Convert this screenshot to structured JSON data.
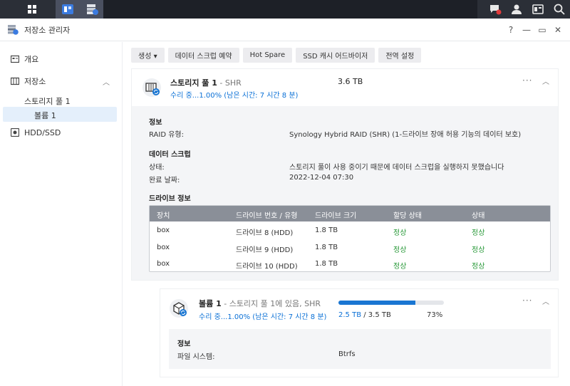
{
  "window": {
    "title": "저장소 관리자",
    "help": "?",
    "minimize": "—",
    "restore": "▭",
    "close": "✕"
  },
  "sidebar": {
    "overview": "개요",
    "storage": "저장소",
    "pool": "스토리지 풀 1",
    "volume": "볼륨 1",
    "hdd": "HDD/SSD"
  },
  "toolbar": {
    "create": "생성 ▾",
    "scrub": "데이터 스크럽 예약",
    "hotspare": "Hot Spare",
    "ssd": "SSD 캐시 어드바이저",
    "global": "전역 설정"
  },
  "pool": {
    "name": "스토리지 풀 1",
    "type": " - SHR",
    "status": "수리 중...1.00% (남은 시간: 7 시간 8 분)",
    "capacity": "3.6 TB",
    "info_title": "정보",
    "raid_label": "RAID 유형:",
    "raid_value": "Synology Hybrid RAID (SHR) (1-드라이브 장애 허용 기능의 데이터 보호)",
    "scrub_title": "데이터 스크럽",
    "state_label": "상태:",
    "state_value": "스토리지 풀이 사용 중이기 때문에 데이터 스크럽을 실행하지 못했습니다",
    "done_label": "완료 날짜:",
    "done_value": "2022-12-04 07:30",
    "drive_title": "드라이브 정보"
  },
  "drives": {
    "headers": [
      "장치",
      "드라이브 번호 / 유형",
      "드라이브 크기",
      "할당 상태",
      "상태"
    ],
    "rows": [
      [
        "box",
        "드라이브 8 (HDD)",
        "1.8 TB",
        "정상",
        "정상"
      ],
      [
        "box",
        "드라이브 9 (HDD)",
        "1.8 TB",
        "정상",
        "정상"
      ],
      [
        "box",
        "드라이브 10 (HDD)",
        "1.8 TB",
        "정상",
        "정상"
      ]
    ]
  },
  "volume": {
    "name": "볼륨 1",
    "sub": " - 스토리지 풀 1에 있음, SHR",
    "status": "수리 중...1.00% (남은 시간: 7 시간 8 분)",
    "used": "2.5 TB",
    "total": " / 3.5 TB",
    "percent": "73%",
    "usage_fraction": 0.73,
    "info_title": "정보",
    "fs_label": "파일 시스템:",
    "fs_value": "Btrfs"
  },
  "colors": {
    "accent": "#0a70d6",
    "ok": "#2a9a3a",
    "taskbar": "#2b2f37"
  }
}
